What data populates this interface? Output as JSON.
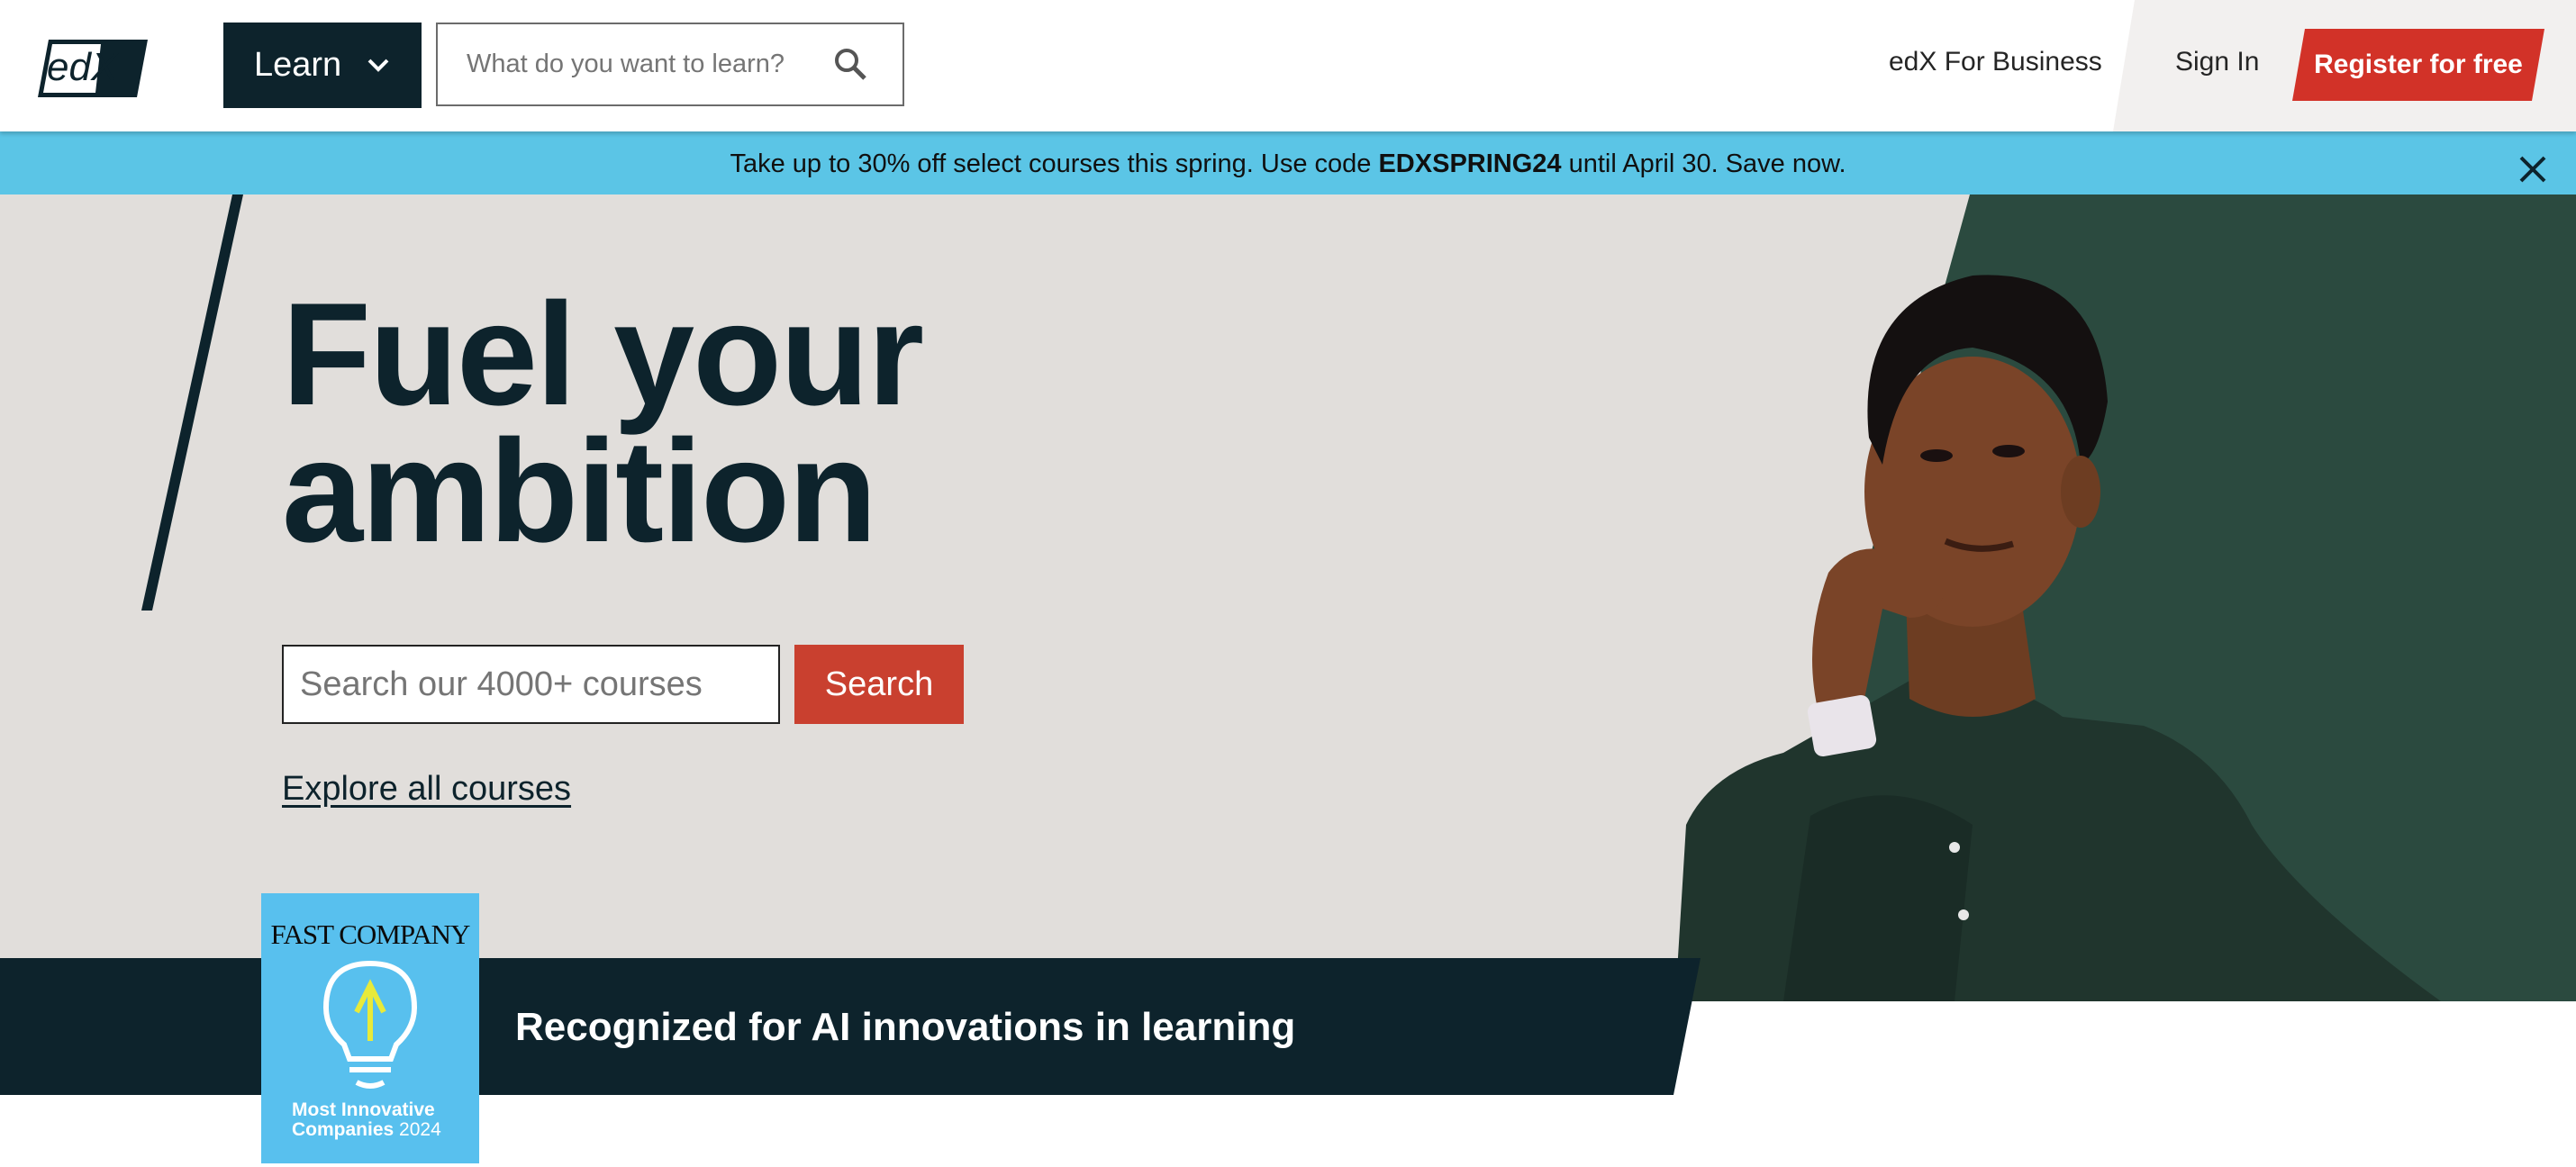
{
  "header": {
    "logo_text": "edX",
    "learn_label": "Learn",
    "search_placeholder": "What do you want to learn?",
    "business_link": "edX For Business",
    "sign_in": "Sign In",
    "register": "Register for free"
  },
  "promo": {
    "text_before": "Take up to 30% off select courses this spring. Use code ",
    "code": "EDXSPRING24",
    "text_after": " until April 30. Save now."
  },
  "hero": {
    "title_line1": "Fuel your",
    "title_line2": "ambition",
    "search_placeholder": "Search our 4000+ courses",
    "search_button": "Search",
    "explore_link": "Explore all courses"
  },
  "recognition": {
    "text": "Recognized for AI innovations in learning",
    "badge_brand": "FAST COMPANY",
    "badge_line1": "Most Innovative",
    "badge_line2": "Companies",
    "badge_year": "2024"
  },
  "colors": {
    "brand_dark": "#0d232c",
    "accent_red": "#d23228",
    "promo_blue": "#5bc5e6",
    "hero_bg": "#e1dedb",
    "hero_green": "#2b4a3f",
    "badge_blue": "#58c0ee"
  },
  "icons": {
    "learn_chevron": "chevron-down-icon",
    "top_search": "search-icon",
    "promo_close": "close-icon",
    "badge": "lightbulb-icon"
  }
}
